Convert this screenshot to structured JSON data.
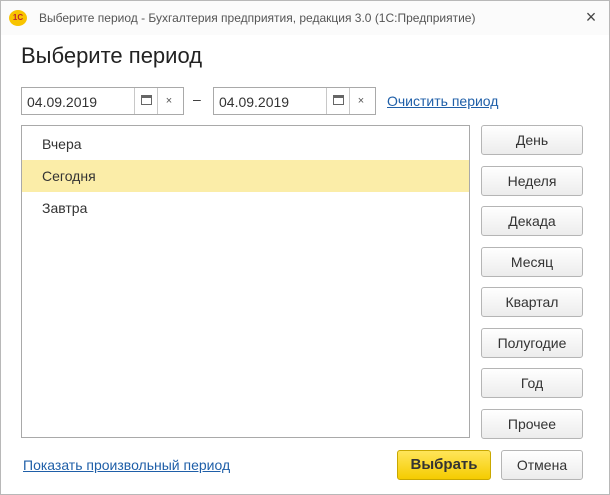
{
  "window": {
    "title": "Выберите период - Бухгалтерия предприятия, редакция 3.0  (1С:Предприятие)",
    "app_icon_text": "1С",
    "close_glyph": "×"
  },
  "heading": "Выберите период",
  "period": {
    "start_date": "04.09.2019",
    "end_date": "04.09.2019",
    "separator": "–",
    "clear_glyph": "×",
    "clear_link": "Очистить период"
  },
  "list": {
    "items": [
      {
        "label": "Вчера",
        "selected": false
      },
      {
        "label": "Сегодня",
        "selected": true
      },
      {
        "label": "Завтра",
        "selected": false
      }
    ]
  },
  "side_buttons": [
    "День",
    "Неделя",
    "Декада",
    "Месяц",
    "Квартал",
    "Полугодие",
    "Год",
    "Прочее"
  ],
  "footer": {
    "custom_period_link": "Показать произвольный период",
    "select_label": "Выбрать",
    "cancel_label": "Отмена"
  },
  "colors": {
    "selected_row": "#fbeda8",
    "primary_button": "#f5cc00",
    "link": "#1f5fa8"
  },
  "icons": {
    "app": "1c-logo-icon",
    "calendar": "calendar-icon",
    "clear": "clear-x-icon",
    "close": "close-icon"
  }
}
